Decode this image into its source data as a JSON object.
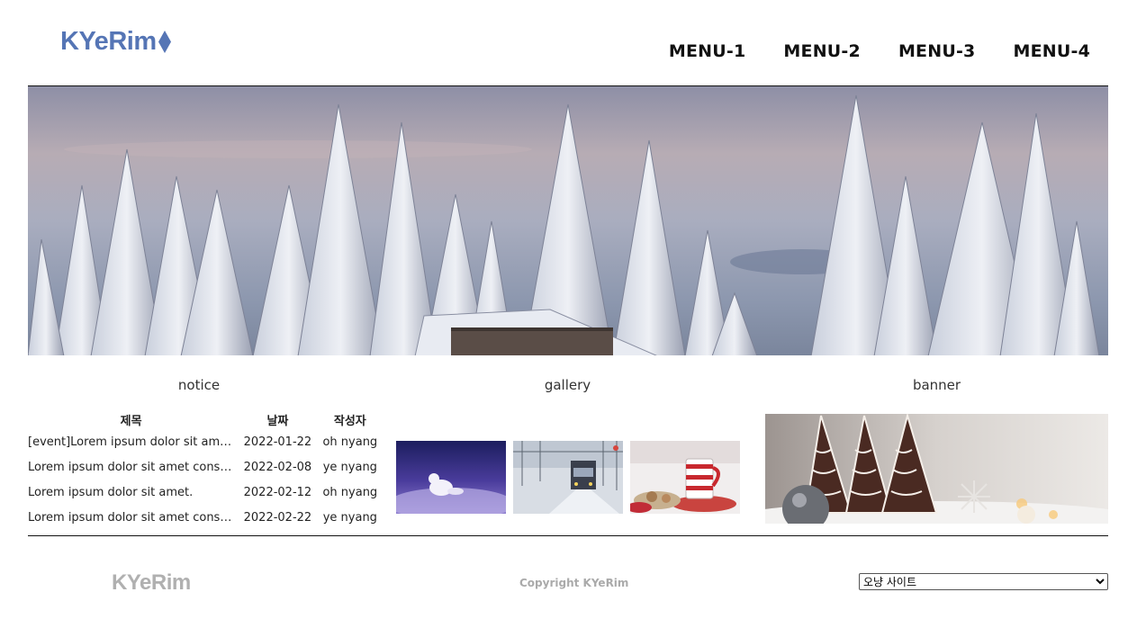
{
  "header": {
    "logo_text": "KYeRim",
    "logo_icon": "diamond-icon",
    "nav": [
      {
        "label": "MENU-1"
      },
      {
        "label": "MENU-2"
      },
      {
        "label": "MENU-3"
      },
      {
        "label": "MENU-4"
      }
    ]
  },
  "hero": {
    "image": "snow-covered-pine-forest-with-cabin-roof"
  },
  "sections": {
    "notice_title": "notice",
    "gallery_title": "gallery",
    "banner_title": "banner"
  },
  "notice": {
    "columns": [
      "제목",
      "날짜",
      "작성자"
    ],
    "rows": [
      {
        "title": "[event]Lorem ipsum dolor sit amet.",
        "date": "2022-01-22",
        "author": "oh nyang"
      },
      {
        "title": "Lorem ipsum dolor sit amet consectetur.",
        "date": "2022-02-08",
        "author": "ye nyang"
      },
      {
        "title": "Lorem ipsum dolor sit amet.",
        "date": "2022-02-12",
        "author": "oh nyang"
      },
      {
        "title": "Lorem ipsum dolor sit amet consectetur.",
        "date": "2022-02-22",
        "author": "ye nyang"
      }
    ]
  },
  "gallery": {
    "images": [
      "arctic-fox-on-snow",
      "train-in-snowy-station",
      "striped-mug-with-cookies"
    ]
  },
  "banner": {
    "image": "chocolate-christmas-tree-cookies"
  },
  "footer": {
    "logo_text": "KYeRim",
    "copyright": "Copyright KYeRim",
    "site_select": {
      "selected": "오냥 사이트",
      "options": [
        "오냥 사이트"
      ]
    }
  },
  "colors": {
    "brand": "#5575b5",
    "footer_gray": "#aaaaaa"
  }
}
